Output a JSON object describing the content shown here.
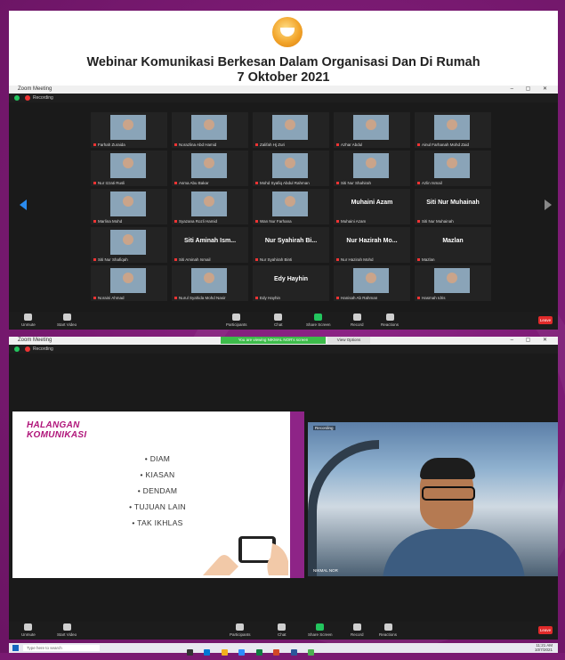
{
  "header": {
    "title": "Webinar Komunikasi Berkesan Dalam Organisasi Dan Di Rumah",
    "date": "7 Oktober 2021"
  },
  "meeting1": {
    "window_title": "Zoom Meeting",
    "recording_label": "Recording",
    "tiles": [
      {
        "name": "Farhah Zuraida"
      },
      {
        "name": "Norazlina Abd Hamid"
      },
      {
        "name": "Zalifah Hj Zuri"
      },
      {
        "name": "Azhar Abdul"
      },
      {
        "name": "Ainul Farhanah Mohd Zaid"
      },
      {
        "name": "Nur Izzati Rusli"
      },
      {
        "name": "Asma Abu Bakar"
      },
      {
        "name": "Mohd Syafiq Abdul Rahman"
      },
      {
        "name": "Siti Nur Shahirah"
      },
      {
        "name": "Azlin Ismail"
      },
      {
        "name": "Marlina Mohd"
      },
      {
        "name": "Syazana Rozli Hamid"
      },
      {
        "name": "Wan Nur Farhana"
      },
      {
        "name": "Muhaini Azam",
        "big": "Muhaini Azam"
      },
      {
        "name": "Siti Nur Muhainah",
        "big": "Siti Nur Muhainah"
      },
      {
        "name": "Siti Nur Shafiqah"
      },
      {
        "name": "Siti Aminah Ismail",
        "big": "Siti Aminah Ism..."
      },
      {
        "name": "Nur Syahirah Binti",
        "big": "Nur Syahirah Bi..."
      },
      {
        "name": "Nur Hazirah Mohd",
        "big": "Nur Hazirah Mo..."
      },
      {
        "name": "Mazlan",
        "big": "Mazlan"
      },
      {
        "name": "Noraini Ahmad"
      },
      {
        "name": "Nurul Syahida Mohd Nasir"
      },
      {
        "name": "Edy Hayhin",
        "big": "Edy Hayhin"
      },
      {
        "name": "Hanisah Ab Rahman"
      },
      {
        "name": "Hasmah Idris"
      }
    ],
    "controls": [
      "Unmute",
      "Start Video",
      "Participants",
      "Chat",
      "Share Screen",
      "Record",
      "Reactions"
    ],
    "end_label": "Leave"
  },
  "meeting2": {
    "window_title": "Zoom Meeting",
    "recording_label": "Recording",
    "share_banner": "You are viewing NIKMAL NOR's screen",
    "share_stop": "View Options",
    "slide": {
      "heading_line1": "HALANGAN",
      "heading_line2": "KOMUNIKASI",
      "bullets": [
        "• DIAM",
        "• KIASAN",
        "• DENDAM",
        "• TUJUAN LAIN",
        "• TAK IKHLAS"
      ]
    },
    "camera": {
      "label": "NIKMAL NOR",
      "top_label": "Recording"
    },
    "controls": [
      "Unmute",
      "Start Video",
      "Participants",
      "Chat",
      "Share Screen",
      "Record",
      "Reactions"
    ],
    "end_label": "Leave"
  },
  "taskbar": {
    "search_placeholder": "Type here to search",
    "time": "11:21 AM",
    "date": "10/7/2021"
  },
  "colors": {
    "background": "#7a1a72",
    "zoom_dark": "#1a1a1a",
    "accent_green": "#23c55e",
    "leave_red": "#e02a2a",
    "slide_heading": "#b0157a"
  }
}
